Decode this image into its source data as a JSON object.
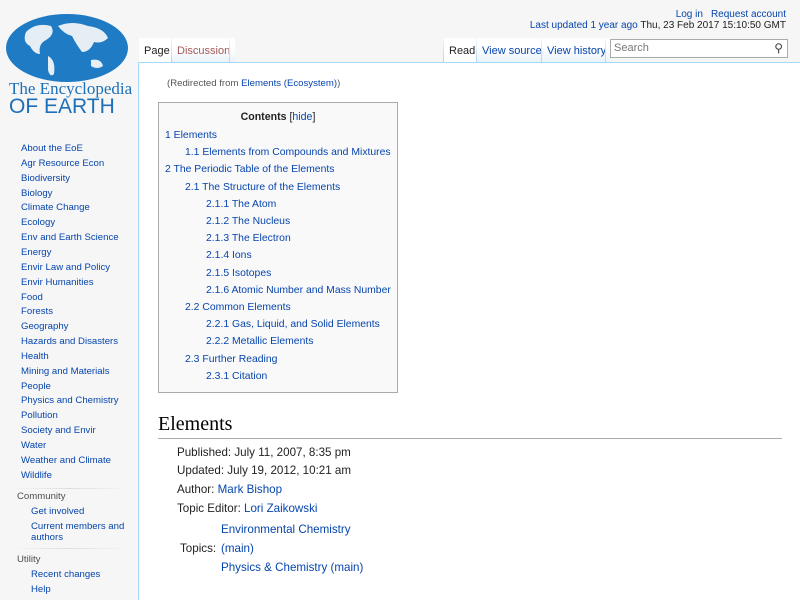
{
  "logo": {
    "line1": "The Encyclopedia",
    "line2": "OF EARTH"
  },
  "sidebar": {
    "items": [
      "About the EoE",
      "Agr Resource Econ",
      "Biodiversity",
      "Biology",
      "Climate Change",
      "Ecology",
      "Env and Earth Science",
      "Energy",
      "Envir Law and Policy",
      "Envir Humanities",
      "Food",
      "Forests",
      "Geography",
      "Hazards and Disasters",
      "Health",
      "Mining and Materials",
      "People",
      "Physics and Chemistry",
      "Pollution",
      "Society and Envir",
      "Water",
      "Weather and Climate",
      "Wildlife"
    ],
    "community": {
      "heading": "Community",
      "items": [
        "Get involved",
        "Current members and authors"
      ]
    },
    "utility": {
      "heading": "Utility",
      "items": [
        "Recent changes",
        "Help"
      ]
    }
  },
  "personal": {
    "login": "Log in",
    "request": "Request account"
  },
  "last_updated": {
    "label": "Last updated",
    "ago": "1 year ago",
    "date": "Thu, 23 Feb 2017 15:10:50 GMT"
  },
  "tabs": {
    "page": "Page",
    "discussion": "Discussion",
    "read": "Read",
    "view_source": "View source",
    "view_history": "View history"
  },
  "search": {
    "placeholder": "Search"
  },
  "redirect": {
    "prefix": "(Redirected from ",
    "link": "Elements (Ecosystem)",
    "suffix": ")"
  },
  "toc": {
    "title": "Contents",
    "hide": "hide",
    "entries": [
      {
        "num": "1",
        "text": "Elements",
        "level": 1
      },
      {
        "num": "1.1",
        "text": "Elements from Compounds and Mixtures",
        "level": 2
      },
      {
        "num": "2",
        "text": "The Periodic Table of the Elements",
        "level": 1
      },
      {
        "num": "2.1",
        "text": "The Structure of the Elements",
        "level": 2
      },
      {
        "num": "2.1.1",
        "text": "The Atom",
        "level": 3
      },
      {
        "num": "2.1.2",
        "text": "The Nucleus",
        "level": 3
      },
      {
        "num": "2.1.3",
        "text": "The Electron",
        "level": 3
      },
      {
        "num": "2.1.4",
        "text": "Ions",
        "level": 3
      },
      {
        "num": "2.1.5",
        "text": "Isotopes",
        "level": 3
      },
      {
        "num": "2.1.6",
        "text": "Atomic Number and Mass Number",
        "level": 3
      },
      {
        "num": "2.2",
        "text": "Common Elements",
        "level": 2
      },
      {
        "num": "2.2.1",
        "text": "Gas, Liquid, and Solid Elements",
        "level": 3
      },
      {
        "num": "2.2.2",
        "text": "Metallic Elements",
        "level": 3
      },
      {
        "num": "2.3",
        "text": "Further Reading",
        "level": 2
      },
      {
        "num": "2.3.1",
        "text": "Citation",
        "level": 3
      }
    ]
  },
  "article": {
    "title": "Elements",
    "published": "Published: July 11, 2007, 8:35 pm",
    "updated": "Updated: July 19, 2012, 10:21 am",
    "author_label": "Author: ",
    "author": "Mark Bishop",
    "editor_label": "Topic Editor: ",
    "editor": "Lori Zaikowski",
    "topics_label": "Topics:",
    "topics": [
      "Environmental Chemistry",
      "(main)",
      "Physics & Chemistry (main)"
    ]
  }
}
